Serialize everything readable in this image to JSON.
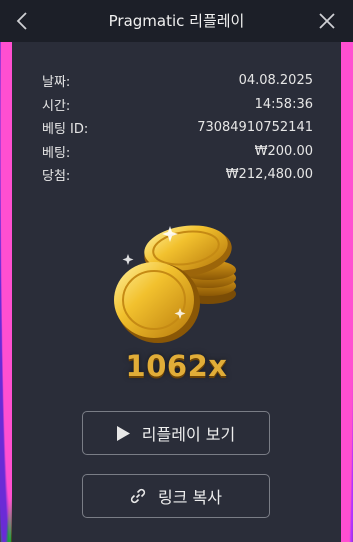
{
  "header": {
    "title": "Pragmatic 리플레이"
  },
  "info": {
    "rows": [
      {
        "label": "날짜:",
        "value": "04.08.2025"
      },
      {
        "label": "시간:",
        "value": "14:58:36"
      },
      {
        "label": "베팅 ID:",
        "value": "73084910752141"
      },
      {
        "label": "베팅:",
        "value": "₩200.00"
      },
      {
        "label": "당첨:",
        "value": "₩212,480.00"
      }
    ]
  },
  "result": {
    "multiplier": "1062x"
  },
  "buttons": {
    "replay_label": "리플레이 보기",
    "copy_label": "링크 복사"
  },
  "colors": {
    "accent_gold": "#e1ad38",
    "panel_bg": "#2a2d39",
    "header_bg": "#1c1f28"
  }
}
